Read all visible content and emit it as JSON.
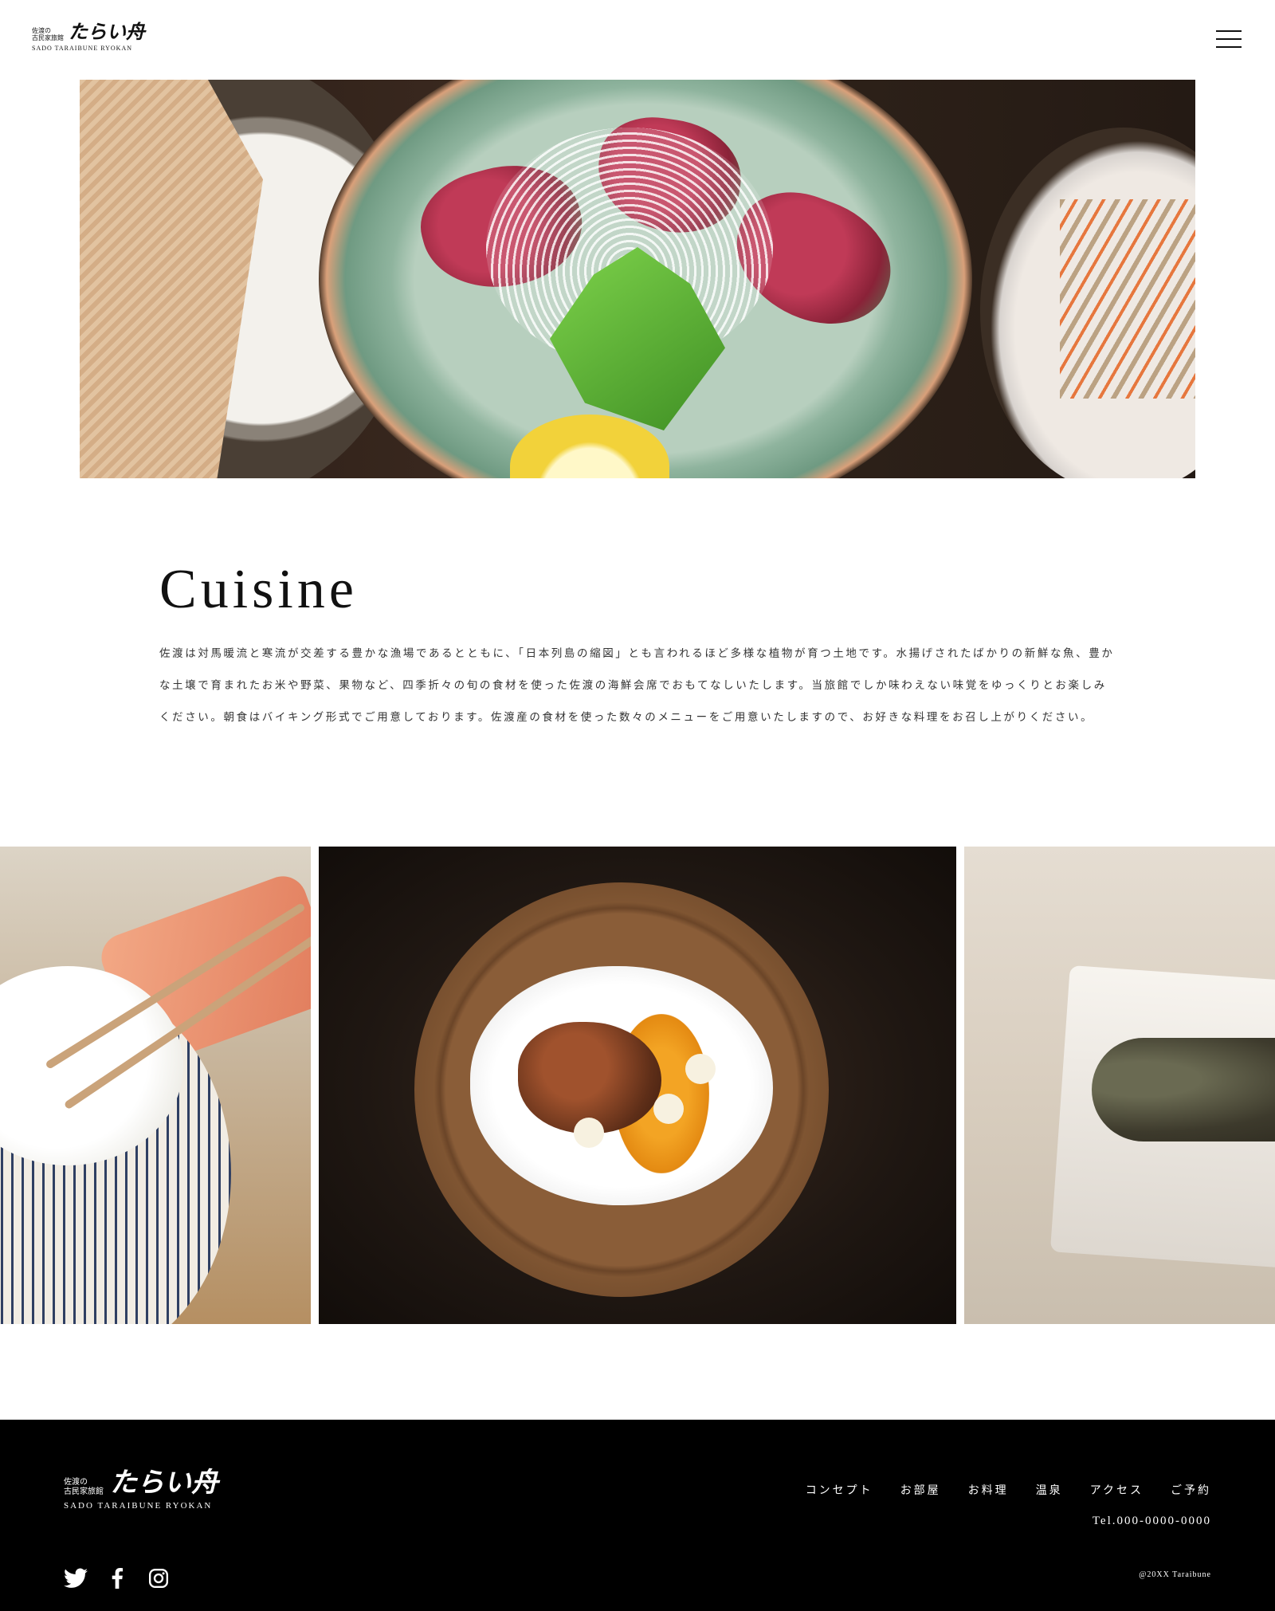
{
  "header": {
    "logo": {
      "sub_line1": "佐渡の",
      "sub_line2": "古民家旅館",
      "main": "たらい舟",
      "en": "SADO TARAIBUNE RYOKAN"
    },
    "menu_label": "menu-icon"
  },
  "cuisine": {
    "title": "Cuisine",
    "body": "佐渡は対馬暖流と寒流が交差する豊かな漁場であるとともに、「日本列島の縮図」とも言われるほど多様な植物が育つ土地です。水揚げされたばかりの新鮮な魚、豊かな土壌で育まれたお米や野菜、果物など、四季折々の旬の食材を使った佐渡の海鮮会席でおもてなしいたします。当旅館でしか味わえない味覚をゆっくりとお楽しみください。朝食はバイキング形式でご用意しております。佐渡産の食材を使った数々のメニューをご用意いたしますので、お好きな料理をお召し上がりください。"
  },
  "footer": {
    "logo": {
      "sub_line1": "佐渡の",
      "sub_line2": "古民家旅館",
      "main": "たらい舟",
      "en": "SADO TARAIBUNE RYOKAN"
    },
    "nav": [
      "コンセプト",
      "お部屋",
      "お料理",
      "温泉",
      "アクセス",
      "ご予約"
    ],
    "tel": "Tel.000-0000-0000",
    "social_icons": [
      "twitter-icon",
      "facebook-icon",
      "instagram-icon"
    ],
    "copyright": "@20XX Taraibune"
  },
  "colors": {
    "footer_bg": "#000000",
    "text": "#222222"
  }
}
